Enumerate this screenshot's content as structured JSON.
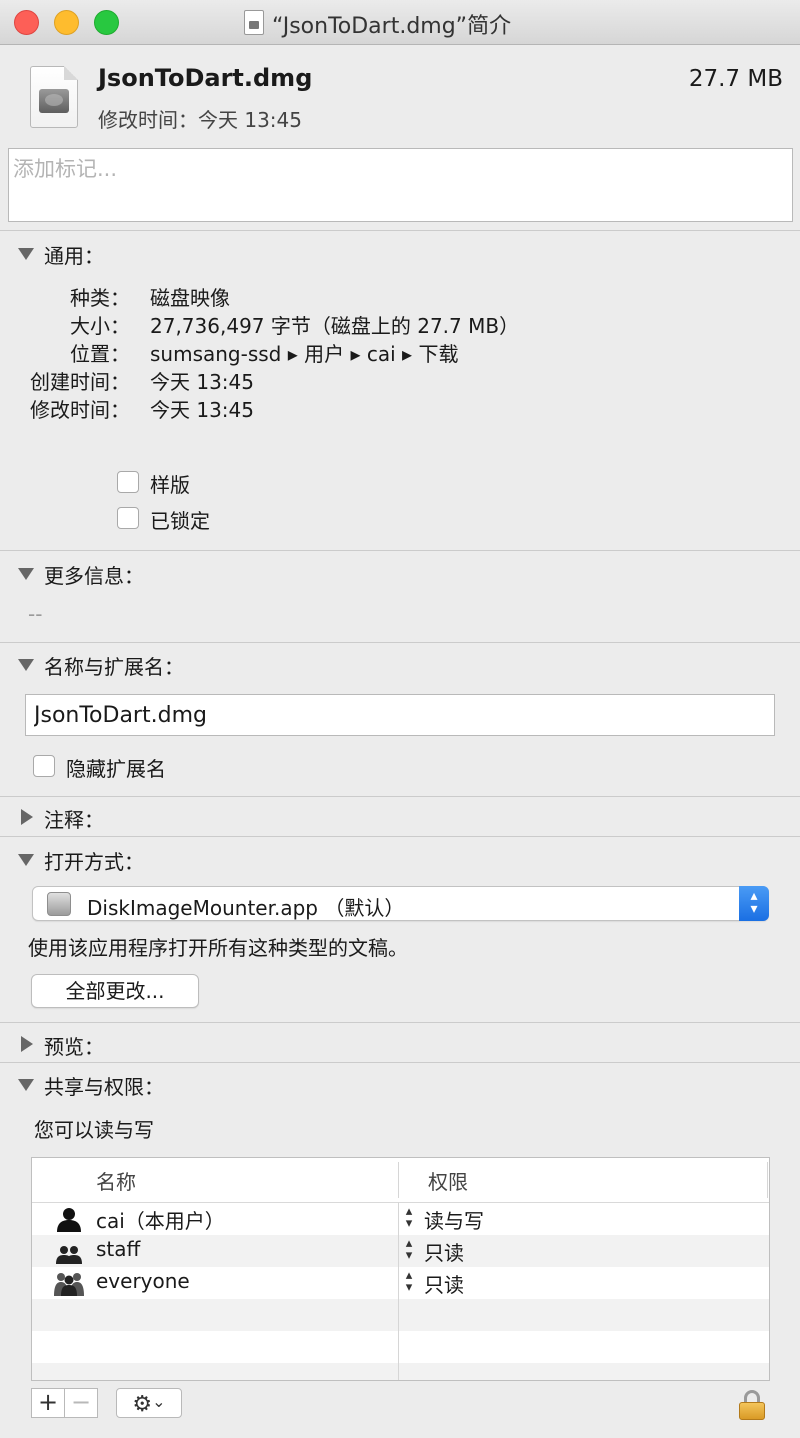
{
  "window": {
    "title": "“JsonToDart.dmg”简介"
  },
  "header": {
    "filename": "JsonToDart.dmg",
    "size": "27.7 MB",
    "modified": "修改时间：今天 13:45"
  },
  "tags": {
    "placeholder": "添加标记..."
  },
  "general": {
    "title": "通用：",
    "rows": [
      {
        "label": "种类：",
        "value": "磁盘映像"
      },
      {
        "label": "大小：",
        "value": "27,736,497 字节（磁盘上的 27.7 MB）"
      },
      {
        "label": "位置：",
        "value": "sumsang-ssd ▸ 用户 ▸ cai ▸ 下载"
      },
      {
        "label": "创建时间：",
        "value": "今天 13:45"
      },
      {
        "label": "修改时间：",
        "value": "今天 13:45"
      }
    ],
    "stationery_label": "样版",
    "locked_label": "已锁定"
  },
  "more_info": {
    "title": "更多信息：",
    "value": "--"
  },
  "name_ext": {
    "title": "名称与扩展名：",
    "value": "JsonToDart.dmg",
    "hide_ext_label": "隐藏扩展名"
  },
  "comments": {
    "title": "注释："
  },
  "open_with": {
    "title": "打开方式：",
    "app": "DiskImageMounter.app （默认）",
    "description": "使用该应用程序打开所有这种类型的文稿。",
    "change_all_label": "全部更改..."
  },
  "preview": {
    "title": "预览："
  },
  "sharing": {
    "title": "共享与权限：",
    "summary": "您可以读与写",
    "col_name": "名称",
    "col_privilege": "权限",
    "rows": [
      {
        "name": "cai（本用户）",
        "privilege": "读与写",
        "icon": "single-user-icon"
      },
      {
        "name": "staff",
        "privilege": "只读",
        "icon": "group-icon"
      },
      {
        "name": "everyone",
        "privilege": "只读",
        "icon": "everyone-icon"
      }
    ]
  },
  "toolbar": {
    "add_symbol": "+",
    "remove_symbol": "−",
    "gear_symbol": "⚙",
    "chevron_symbol": "⌄"
  },
  "colors": {
    "accent": "#1a6fe3",
    "window_bg": "#ececec"
  }
}
